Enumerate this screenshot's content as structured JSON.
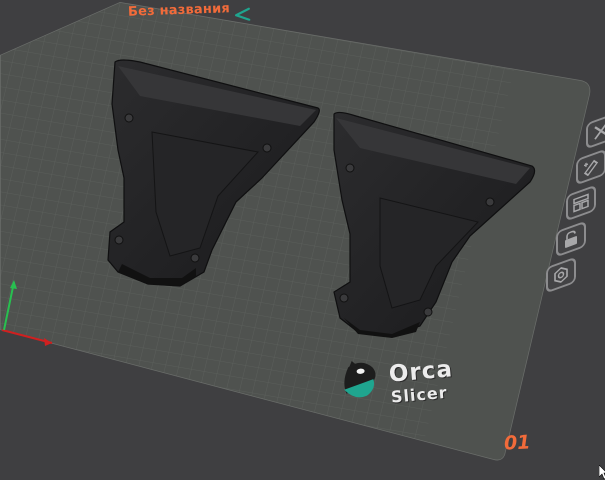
{
  "plate": {
    "name": "Без названия",
    "number": "01",
    "name_color": "#f26b3a",
    "edit_icon": "pencil-edit-icon"
  },
  "logo": {
    "line1": "Orca",
    "line2": "Slicer",
    "mark_icon": "orca-whale-icon"
  },
  "toolbar": {
    "buttons": [
      {
        "name": "delete-plate-icon",
        "title": "Delete plate"
      },
      {
        "name": "auto-orient-icon",
        "title": "Auto orient"
      },
      {
        "name": "arrange-icon",
        "title": "Arrange"
      },
      {
        "name": "lock-icon",
        "title": "Lock plate"
      },
      {
        "name": "plate-settings-icon",
        "title": "Plate settings"
      }
    ]
  },
  "colors": {
    "background": "#3f3f41",
    "bed": "#4f524f",
    "grid": "#5e625e",
    "accent_orange": "#f26b3a",
    "accent_teal": "#1fa58f",
    "x_axis": "#d02020",
    "y_axis": "#28c050"
  }
}
